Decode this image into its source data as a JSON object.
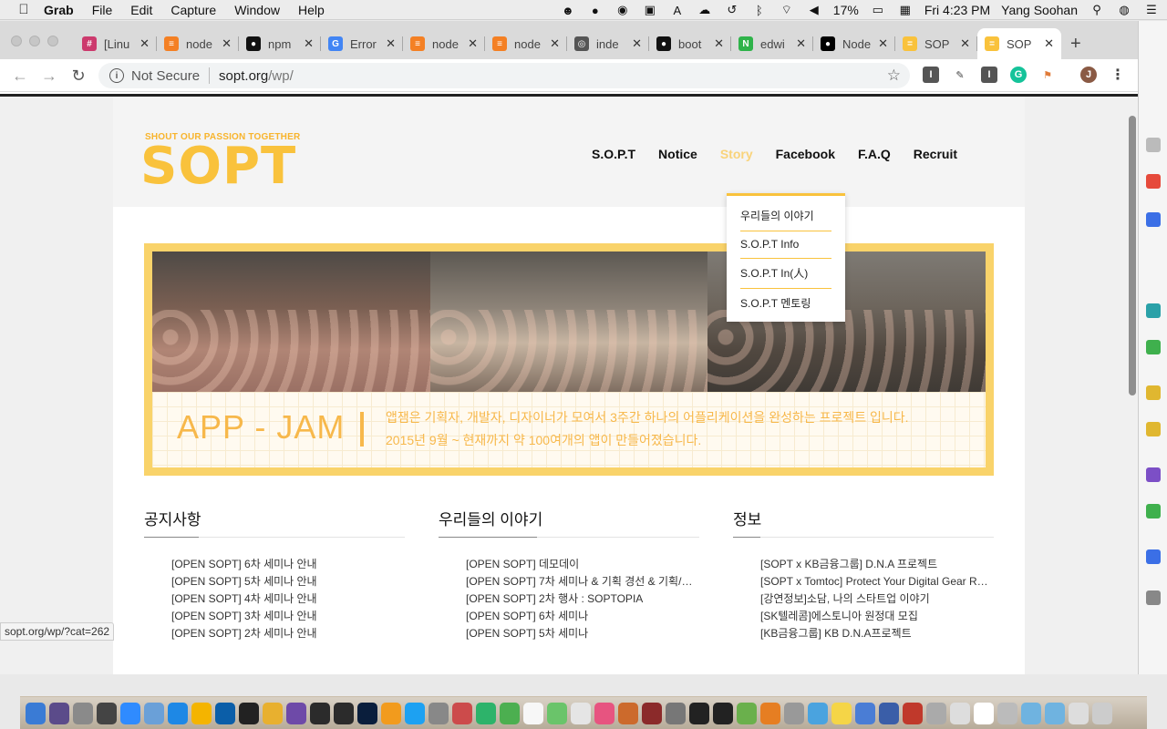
{
  "menubar": {
    "app_name": "Grab",
    "items": [
      "File",
      "Edit",
      "Capture",
      "Window",
      "Help"
    ],
    "battery": "17%",
    "clock": "Fri 4:23 PM",
    "user": "Yang Soohan"
  },
  "tabs": [
    {
      "title": "[Linu",
      "color": "#cc3a6d",
      "glyph": "#"
    },
    {
      "title": "node",
      "color": "#f48024",
      "glyph": "≡"
    },
    {
      "title": "npm",
      "color": "#111111",
      "glyph": "●"
    },
    {
      "title": "Error",
      "color": "#4285f4",
      "glyph": "G"
    },
    {
      "title": "node",
      "color": "#f48024",
      "glyph": "≡"
    },
    {
      "title": "node",
      "color": "#f48024",
      "glyph": "≡"
    },
    {
      "title": "inde",
      "color": "#555555",
      "glyph": "◎"
    },
    {
      "title": "boot",
      "color": "#111111",
      "glyph": "●"
    },
    {
      "title": "edwi",
      "color": "#2fb34a",
      "glyph": "N"
    },
    {
      "title": "Node",
      "color": "#000000",
      "glyph": "●"
    },
    {
      "title": "SOP",
      "color": "#f9c23c",
      "glyph": "="
    },
    {
      "title": "SOP",
      "color": "#f9c23c",
      "glyph": "="
    }
  ],
  "address": {
    "security_label": "Not Secure",
    "host": "sopt.org",
    "path": "/wp/"
  },
  "site": {
    "logo_tagline": "SHOUT OUR PASSION TOGETHER",
    "logo": "SOPT",
    "nav": [
      "S.O.P.T",
      "Notice",
      "Story",
      "Facebook",
      "F.A.Q",
      "Recruit"
    ],
    "dropdown": [
      "우리들의 이야기",
      "S.O.P.T Info",
      "S.O.P.T In(人)",
      "S.O.P.T 멘토링"
    ],
    "banner": {
      "title": "APP - JAM",
      "line1": "앱잼은 기획자, 개발자, 디자이너가 모여서 3주간 하나의 어플리케이션을 완성하는 프로젝트 입니다.",
      "line2": "2015년 9월 ~ 현재까지 약 100여개의 앱이 만들어졌습니다."
    },
    "columns": [
      {
        "heading": "공지사항",
        "items": [
          "[OPEN SOPT] 6차 세미나 안내",
          "[OPEN SOPT] 5차 세미나 안내",
          "[OPEN SOPT] 4차 세미나 안내",
          "[OPEN SOPT] 3차 세미나 안내",
          "[OPEN SOPT] 2차 세미나 안내"
        ]
      },
      {
        "heading": "우리들의 이야기",
        "items": [
          "[OPEN SOPT] 데모데이",
          "[OPEN SOPT] 7차 세미나 & 기획 경선 & 기획/디…",
          "[OPEN SOPT] 2차 행사 : SOPTOPIA",
          "[OPEN SOPT] 6차 세미나",
          "[OPEN SOPT] 5차 세미나"
        ]
      },
      {
        "heading": "정보",
        "items": [
          "[SOPT x KB금융그룹] D.N.A 프로젝트",
          "[SOPT x Tomtoc] Protect Your Digital Gear R…",
          "[강연정보]소담, 나의 스타트업 이야기",
          "[SK텔레콤]에스토니아 원정대 모집",
          "[KB금융그룹] KB D.N.A프로젝트"
        ]
      }
    ]
  },
  "status_url": "sopt.org/wp/?cat=262",
  "colors": {
    "brand": "#f9c23c",
    "brand_text": "#f7b84b"
  }
}
